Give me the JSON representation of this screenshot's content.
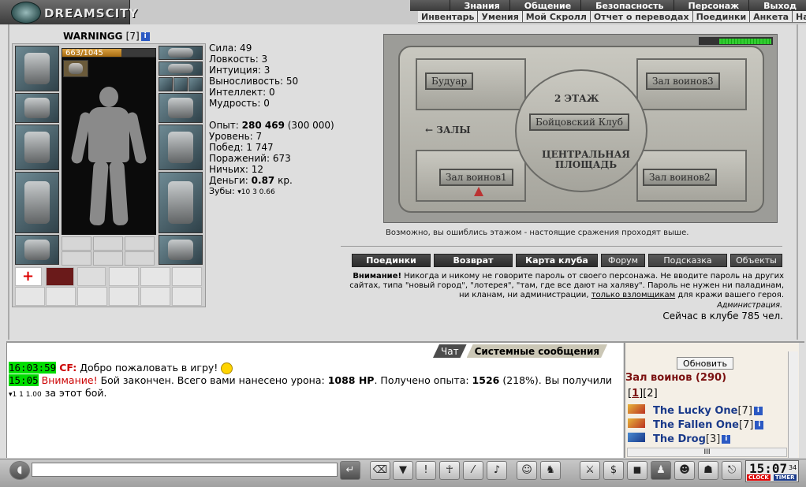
{
  "header": {
    "logo_text": "DREAMSCITY",
    "menu": [
      "Знания",
      "Общение",
      "Безопасность",
      "Персонаж",
      "Выход"
    ],
    "submenu": [
      "Инвентарь",
      "Умения",
      "Мой Скролл",
      "Отчет о переводах",
      "Поединки",
      "Анкета",
      "Настро"
    ]
  },
  "character": {
    "name": "WARNINGG",
    "level": "[7]",
    "info_icon": "i",
    "hp_text": "663/1045",
    "hp_fraction": 0.634
  },
  "stats": {
    "strength": "Сила: 49",
    "agility": "Ловкость: 3",
    "intuition": "Интуиция: 3",
    "endurance": "Выносливость: 50",
    "intellect": "Интеллект: 0",
    "wisdom": "Мудрость: 0",
    "exp_label": "Опыт:",
    "exp_value": "280 469",
    "exp_next": "(300 000)",
    "level": "Уровень: 7",
    "wins": "Побед: 1 747",
    "losses": "Поражений: 673",
    "draws": "Ничьих: 12",
    "money_label": "Деньги:",
    "money_value": "0.87",
    "money_unit": "кр.",
    "teeth_label": "Зубы:",
    "teeth_values": "10 3 0.66"
  },
  "map": {
    "buttons": [
      "Будуар",
      "Зал воинов3",
      "Бойцовский Клуб",
      "Зал воинов1",
      "Зал воинов2"
    ],
    "labels": [
      "2 ЭТАЖ",
      "← ЗАЛЫ",
      "ЦЕНТРАЛЬНАЯ ПЛОЩАДЬ"
    ],
    "hint": "Возможно, вы ошиблись этажом - настоящие сражения проходят выше."
  },
  "nav": {
    "buttons": [
      "Поединки",
      "Возврат",
      "Карта клуба",
      "Форум",
      "Подсказка",
      "Объекты"
    ]
  },
  "warning": {
    "bold": "Внимание!",
    "text": " Никогда и никому не говорите пароль от своего персонажа. Не вводите пароль на других сайтах, типа \"новый город\", \"лотерея\", \"там, где все дают на халяву\". Пароль не нужен ни паладинам, ни кланам, ни администрации, ",
    "link": "только взломщикам",
    "tail": " для кражи вашего героя.",
    "admin": "Администрация.",
    "online": "Сейчас в клубе 785 чел."
  },
  "chat": {
    "tabs": [
      "Чат",
      "Системные сообщения"
    ],
    "messages": [
      {
        "time": "16:03:59",
        "sender": "CF:",
        "text": " Добро пожаловать в игру!"
      },
      {
        "time": "15:05",
        "warn": "Внимание!",
        "text1": " Бой закончен. Всего вами нанесено урона: ",
        "dmg": "1088 HP",
        "text2": ". Получено опыта: ",
        "exp": "1526",
        "text3": " (218%). Вы получили ",
        "reward": "1 1 1.00",
        "text4": " за этот бой."
      }
    ]
  },
  "room": {
    "refresh_label": "Обновить",
    "title": "Зал воинов (290)",
    "page1": "1",
    "page2": "2",
    "players": [
      {
        "name": "The Lucky One",
        "level": "[7]"
      },
      {
        "name": "The Fallen One",
        "level": "[7]"
      },
      {
        "name": "The Drog",
        "level": "[3]"
      }
    ],
    "scroll_label": "III"
  },
  "clock": {
    "time": "15:07",
    "seconds": "34",
    "clock_label": "CLOCK",
    "timer_label": "TIMER"
  },
  "colors": {
    "accent_red": "#7a1010",
    "player_blue": "#1a3a8a",
    "timestamp_green": "#00dd00"
  }
}
